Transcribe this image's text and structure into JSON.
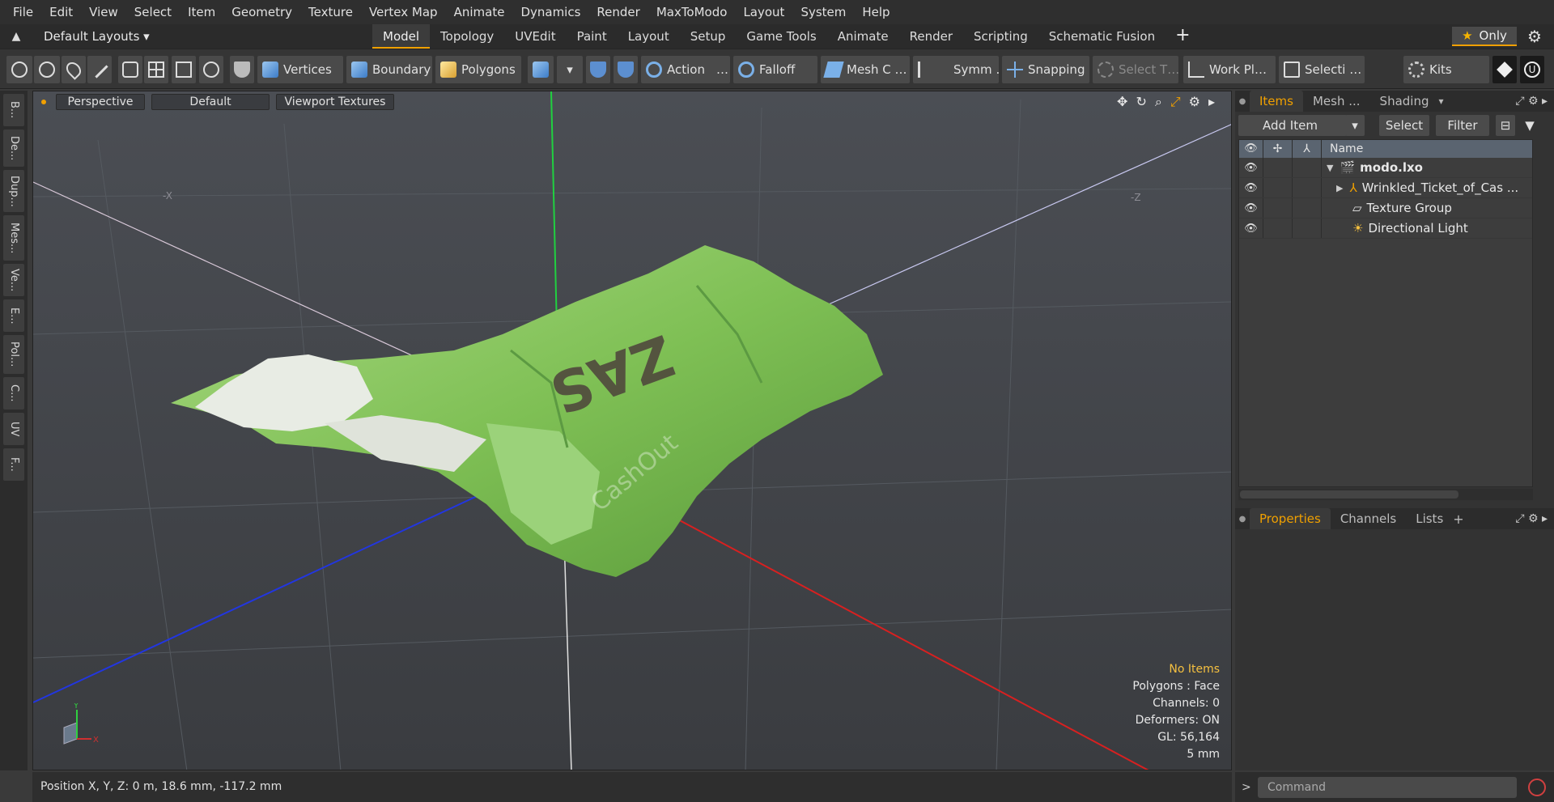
{
  "menu": [
    "File",
    "Edit",
    "View",
    "Select",
    "Item",
    "Geometry",
    "Texture",
    "Vertex Map",
    "Animate",
    "Dynamics",
    "Render",
    "MaxToModo",
    "Layout",
    "System",
    "Help"
  ],
  "layouts": {
    "label": "Default Layouts ▾"
  },
  "tabs": [
    "Model",
    "Topology",
    "UVEdit",
    "Paint",
    "Layout",
    "Setup",
    "Game Tools",
    "Animate",
    "Render",
    "Scripting",
    "Schematic Fusion"
  ],
  "tab_active": "Model",
  "only_label": "Only",
  "toolbar": {
    "vertices": "Vertices",
    "boundary": "Boundary",
    "polygons": "Polygons",
    "action": "Action",
    "action_more": "…",
    "falloff": "Falloff",
    "mesh": "Mesh C …",
    "symm": "Symm …",
    "snapping": "Snapping",
    "select_t": "Select T…",
    "workplane": "Work Pl…",
    "selecti": "Selecti …",
    "kits": "Kits"
  },
  "side_tabs": [
    "B...",
    "De...",
    "Dup...",
    "Mes...",
    "Ve...",
    "E...",
    "Pol...",
    "C...",
    "UV",
    "F..."
  ],
  "viewport": {
    "perspective": "Perspective",
    "default": "Default",
    "textures": "Viewport Textures",
    "axis_z_neg": "-Z",
    "axis_x_neg": "-X",
    "info": {
      "items": "No Items",
      "polygons": "Polygons : Face",
      "channels": "Channels: 0",
      "deformers": "Deformers: ON",
      "gl": "GL: 56,164",
      "scale": "5 mm"
    },
    "gizmo": {
      "y": "Y",
      "x": "X"
    }
  },
  "colors": {
    "accent": "#f0a000",
    "x_axis": "#d02020",
    "y_axis": "#20d040",
    "z_axis": "#2030d0",
    "mesh_green": "#8cc860"
  },
  "items_panel": {
    "tabs": [
      "Items",
      "Mesh ...",
      "Shading"
    ],
    "add_item": "Add Item",
    "select": "Select",
    "filter": "Filter",
    "name_col": "Name",
    "rows": [
      {
        "label": "modo.lxo",
        "bold": true
      },
      {
        "label": "Wrinkled_Ticket_of_Cas ..."
      },
      {
        "label": "Texture Group"
      },
      {
        "label": "Directional Light"
      }
    ]
  },
  "props_panel": {
    "tabs": [
      "Properties",
      "Channels",
      "Lists"
    ]
  },
  "status": {
    "position": "Position X, Y, Z:   0 m, 18.6 mm, -117.2 mm"
  },
  "command": {
    "placeholder": "Command"
  }
}
